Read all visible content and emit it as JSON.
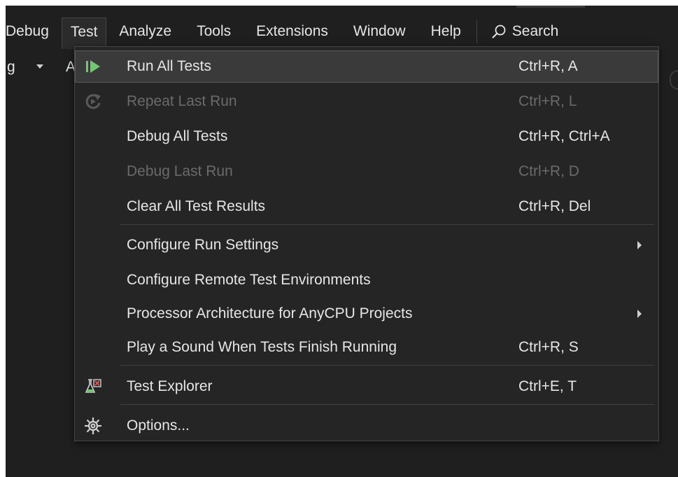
{
  "menubar": {
    "items": [
      "Debug",
      "Test",
      "Analyze",
      "Tools",
      "Extensions",
      "Window",
      "Help"
    ],
    "search_label": "Search"
  },
  "toolbar": {
    "config_text": "g",
    "platform_text": "A"
  },
  "test_menu": {
    "items": [
      {
        "label": "Run All Tests",
        "shortcut": "Ctrl+R, A",
        "icon": "run-all-icon",
        "enabled": true
      },
      {
        "label": "Repeat Last Run",
        "shortcut": "Ctrl+R, L",
        "icon": "repeat-icon",
        "enabled": false
      },
      {
        "label": "Debug All Tests",
        "shortcut": "Ctrl+R, Ctrl+A",
        "enabled": true
      },
      {
        "label": "Debug Last Run",
        "shortcut": "Ctrl+R, D",
        "enabled": false
      },
      {
        "label": "Clear All Test Results",
        "shortcut": "Ctrl+R, Del",
        "enabled": true
      },
      {
        "label": "Configure Run Settings",
        "submenu": true,
        "enabled": true
      },
      {
        "label": "Configure Remote Test Environments",
        "enabled": true
      },
      {
        "label": "Processor Architecture for AnyCPU Projects",
        "submenu": true,
        "enabled": true
      },
      {
        "label": "Play a Sound When Tests Finish Running",
        "shortcut": "Ctrl+R, S",
        "enabled": true
      },
      {
        "label": "Test Explorer",
        "shortcut": "Ctrl+E, T",
        "icon": "test-explorer-icon",
        "enabled": true
      },
      {
        "label": "Options...",
        "icon": "gear-icon",
        "enabled": true
      }
    ]
  },
  "colors": {
    "run_icon_green": "#6fc96f",
    "menu_bg": "#252526",
    "disabled_text": "#6a6a6a"
  }
}
